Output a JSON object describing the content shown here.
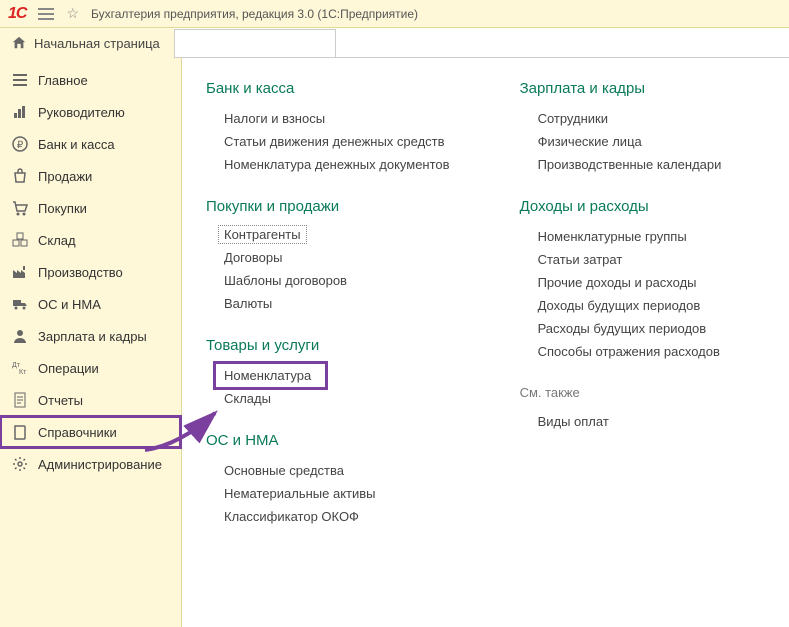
{
  "titlebar": {
    "appTitle": "Бухгалтерия предприятия, редакция 3.0   (1С:Предприятие)"
  },
  "home": {
    "label": "Начальная страница"
  },
  "sidebar": {
    "items": [
      {
        "label": "Главное",
        "icon": "menu"
      },
      {
        "label": "Руководителю",
        "icon": "chart"
      },
      {
        "label": "Банк и касса",
        "icon": "ruble"
      },
      {
        "label": "Продажи",
        "icon": "bag"
      },
      {
        "label": "Покупки",
        "icon": "cart"
      },
      {
        "label": "Склад",
        "icon": "boxes"
      },
      {
        "label": "Производство",
        "icon": "factory"
      },
      {
        "label": "ОС и НМА",
        "icon": "truck"
      },
      {
        "label": "Зарплата и кадры",
        "icon": "person"
      },
      {
        "label": "Операции",
        "icon": "dtht"
      },
      {
        "label": "Отчеты",
        "icon": "report"
      },
      {
        "label": "Справочники",
        "icon": "book",
        "highlighted": true
      },
      {
        "label": "Администрирование",
        "icon": "gear"
      }
    ]
  },
  "main": {
    "left": [
      {
        "title": "Банк и касса",
        "items": [
          "Налоги и взносы",
          "Статьи движения денежных средств",
          "Номенклатура денежных документов"
        ]
      },
      {
        "title": "Покупки и продажи",
        "items": [
          "Контрагенты",
          "Договоры",
          "Шаблоны договоров",
          "Валюты"
        ],
        "dottedIndex": 0
      },
      {
        "title": "Товары и услуги",
        "items": [
          "Номенклатура",
          "Склады"
        ],
        "boxedIndex": 0
      },
      {
        "title": "ОС и НМА",
        "items": [
          "Основные средства",
          "Нематериальные активы",
          "Классификатор ОКОФ"
        ]
      }
    ],
    "right": [
      {
        "title": "Зарплата и кадры",
        "items": [
          "Сотрудники",
          "Физические лица",
          "Производственные календари"
        ]
      },
      {
        "title": "Доходы и расходы",
        "items": [
          "Номенклатурные группы",
          "Статьи затрат",
          "Прочие доходы и расходы",
          "Доходы будущих периодов",
          "Расходы будущих периодов",
          "Способы отражения расходов"
        ]
      }
    ],
    "seeAlso": {
      "label": "См. также",
      "items": [
        "Виды оплат"
      ]
    }
  }
}
